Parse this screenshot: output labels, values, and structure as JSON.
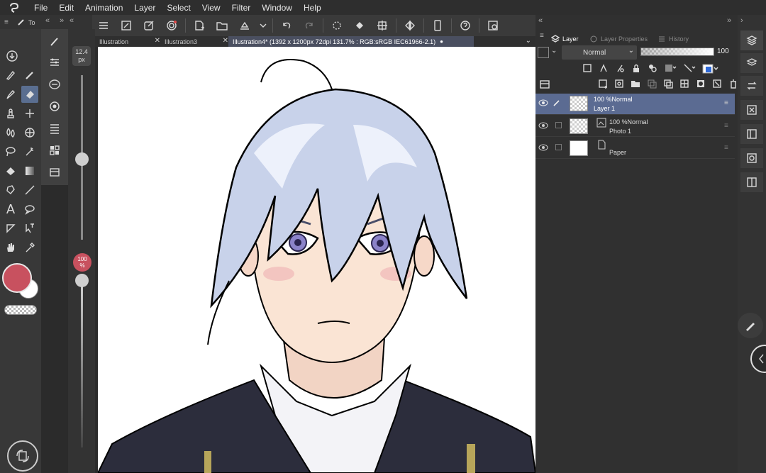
{
  "menu": {
    "items": [
      "File",
      "Edit",
      "Animation",
      "Layer",
      "Select",
      "View",
      "Filter",
      "Window",
      "Help"
    ]
  },
  "tool_panel": {
    "tab_label": "To",
    "brush_size": "12.4",
    "brush_unit": "px",
    "opacity_percent": "100",
    "opacity_unit": "%"
  },
  "document_tabs": [
    {
      "label": "Illustration",
      "active": false
    },
    {
      "label": "Illustration3",
      "active": false
    },
    {
      "label": "Illustration4* (1392 x 1200px 72dpi 131.7% : RGB:sRGB IEC61966-2.1)",
      "active": true
    }
  ],
  "layer_panel": {
    "tabs": [
      "Layer",
      "Layer Properties",
      "History"
    ],
    "blend_mode": "Normal",
    "opacity": "100",
    "layers": [
      {
        "opacity_mode": "100 %Normal",
        "name": "Layer 1",
        "selected": true
      },
      {
        "opacity_mode": "100 %Normal",
        "name": "Photo 1",
        "selected": false
      },
      {
        "opacity_mode": "",
        "name": "Paper",
        "selected": false
      }
    ]
  },
  "colors": {
    "main_color": "#c8515f",
    "sub_color": "#ffffff",
    "selection_blue": "#5b6b92"
  }
}
